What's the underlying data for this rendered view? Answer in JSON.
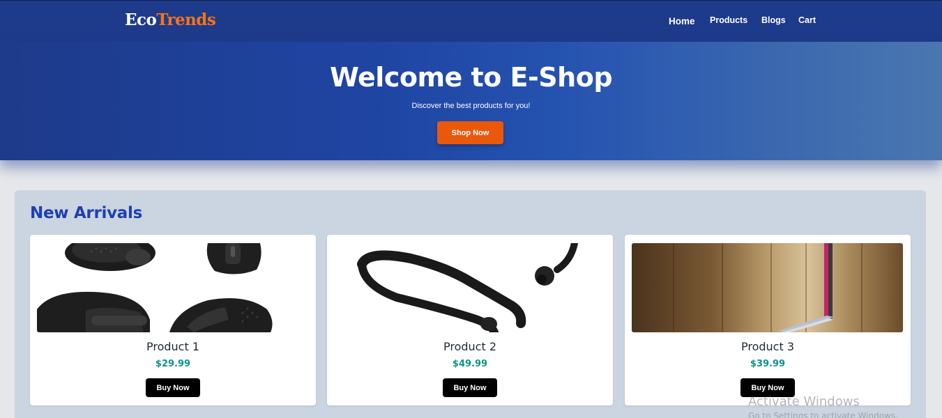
{
  "brand": {
    "part1": "Eco",
    "part2": "Trends",
    "accent_color": "#f97316"
  },
  "nav": {
    "home": "Home",
    "products": "Products",
    "blogs": "Blogs",
    "cart": "Cart"
  },
  "hero": {
    "title": "Welcome to E-Shop",
    "subtitle": "Discover the best products for you!",
    "cta_label": "Shop Now"
  },
  "section": {
    "title": "New Arrivals",
    "products": [
      {
        "name": "Product 1",
        "price": "$29.99",
        "buy_label": "Buy Now",
        "image_icon": "computer-mouse-image"
      },
      {
        "name": "Product 2",
        "price": "$49.99",
        "buy_label": "Buy Now",
        "image_icon": "headphones-image"
      },
      {
        "name": "Product 3",
        "price": "$39.99",
        "buy_label": "Buy Now",
        "image_icon": "laptop-image"
      }
    ]
  },
  "watermark": {
    "title": "Activate Windows",
    "subtitle": "Go to Settings to activate Windows."
  },
  "colors": {
    "navbar": "#1e3a8a",
    "cta": "#ea580c",
    "section_title": "#1e40af",
    "price": "#0d9488"
  }
}
